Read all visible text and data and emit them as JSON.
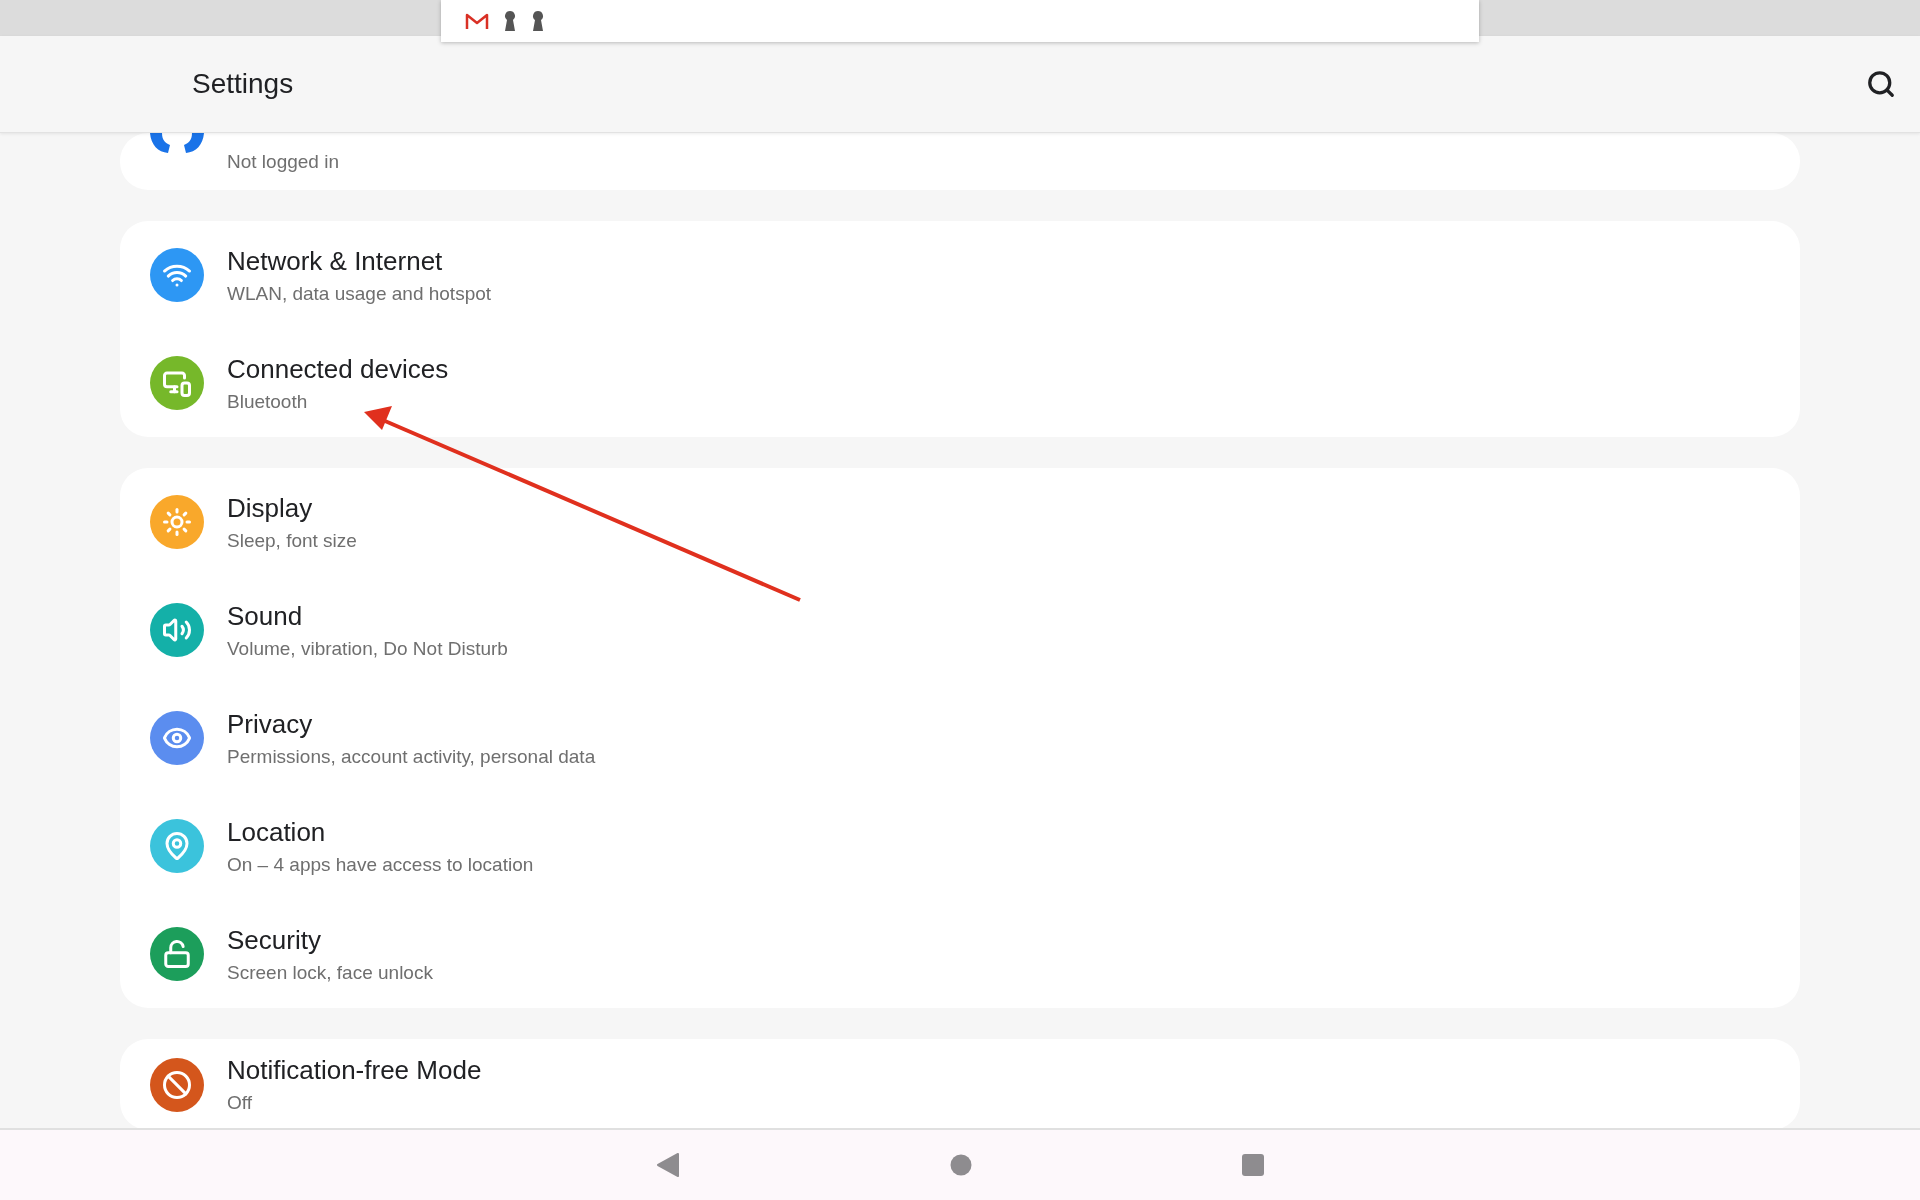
{
  "app_bar": {
    "title": "Settings"
  },
  "groups": [
    {
      "items": [
        {
          "kind": "account",
          "color": "#1a73e8",
          "subtitle": "Not logged in"
        }
      ]
    },
    {
      "items": [
        {
          "kind": "wifi",
          "color": "#2d97f4",
          "title": "Network & Internet",
          "subtitle": "WLAN, data usage and hotspot"
        },
        {
          "kind": "devices",
          "color": "#76b82a",
          "title": "Connected devices",
          "subtitle": "Bluetooth"
        }
      ]
    },
    {
      "items": [
        {
          "kind": "display",
          "color": "#f9a82b",
          "title": "Display",
          "subtitle": "Sleep, font size"
        },
        {
          "kind": "sound",
          "color": "#14b0a8",
          "title": "Sound",
          "subtitle": "Volume, vibration, Do Not Disturb"
        },
        {
          "kind": "privacy",
          "color": "#5b8def",
          "title": "Privacy",
          "subtitle": "Permissions, account activity, personal data"
        },
        {
          "kind": "location",
          "color": "#3bc3dc",
          "title": "Location",
          "subtitle": "On – 4 apps have access to location"
        },
        {
          "kind": "security",
          "color": "#1c9e5b",
          "title": "Security",
          "subtitle": "Screen lock, face unlock"
        }
      ]
    },
    {
      "items": [
        {
          "kind": "block",
          "color": "#d4561c",
          "title": "Notification-free Mode",
          "subtitle": "Off"
        }
      ]
    }
  ]
}
